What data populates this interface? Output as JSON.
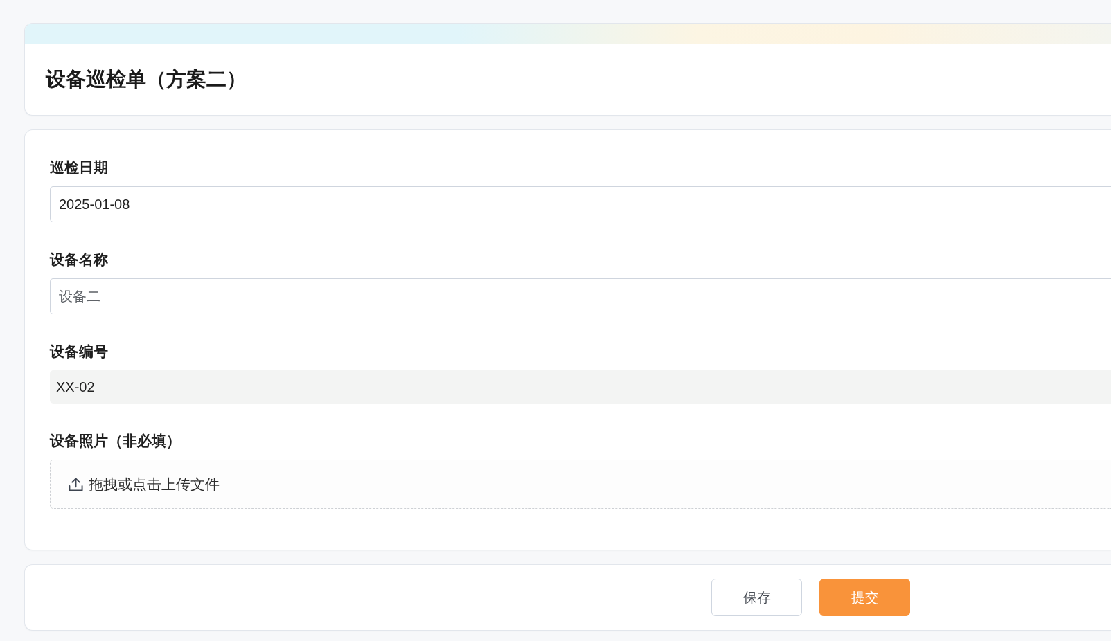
{
  "header": {
    "title": "设备巡检单（方案二）"
  },
  "form": {
    "fields": [
      {
        "kind": "date",
        "label": "巡检日期",
        "value": "2025-01-08"
      },
      {
        "kind": "text",
        "label": "设备名称",
        "placeholder": "设备二"
      },
      {
        "kind": "readonly",
        "label": "设备编号",
        "value": "XX-02"
      },
      {
        "kind": "upload",
        "label": "设备照片（非必填）",
        "hint": "拖拽或点击上传文件"
      }
    ]
  },
  "actions": [
    {
      "kind": "secondary",
      "label": "保存"
    },
    {
      "kind": "primary",
      "label": "提交"
    }
  ]
}
